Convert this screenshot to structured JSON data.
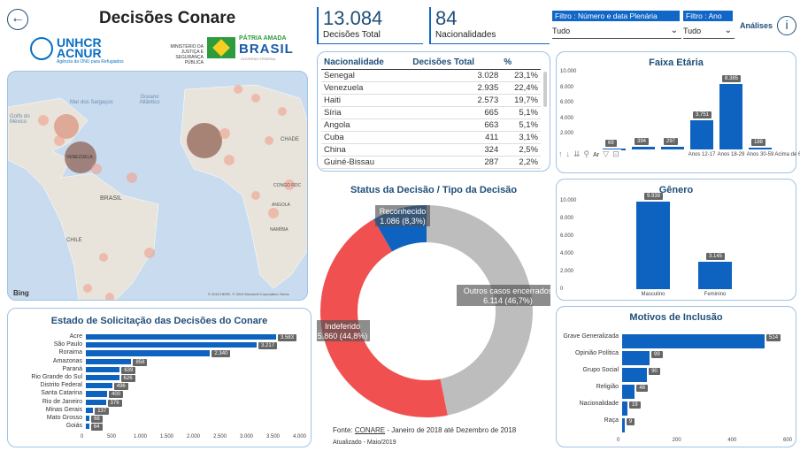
{
  "header": {
    "title": "Decisões Conare",
    "unhcr_line1": "UNHCR",
    "unhcr_line2": "ACNUR",
    "unhcr_sub": "Agência da ONU para Refugiados",
    "ministry": "MINISTÉRIO DA JUSTIÇA E SEGURANÇA PÚBLICA",
    "brasil_top": "PÁTRIA AMADA",
    "brasil_main": "BRASIL",
    "brasil_sub": "GOVERNO FEDERAL"
  },
  "kpis": {
    "decisoes_value": "13.084",
    "decisoes_label": "Decisões Total",
    "nac_value": "84",
    "nac_label": "Nacionalidades"
  },
  "filters": {
    "f1_label": "Filtro : Número e data Plenária",
    "f1_value": "Tudo",
    "f2_label": "Filtro : Ano",
    "f2_value": "Tudo",
    "analises": "Análises"
  },
  "map": {
    "ocean1": "Mar dos Sargaços",
    "ocean2": "Oceano Atlântico",
    "golfo": "Golfo do México",
    "brasil": "BRASIL",
    "chile": "CHILE",
    "venezuela": "VENEZUELA",
    "chade": "CHADE",
    "congo": "CONGO RDC",
    "namibia": "NAMÍBIA",
    "angola": "ANGOLA",
    "bing": "Bing",
    "copyright": "© 2019 HERE, © 2019 Microsoft Corporation Terms"
  },
  "table": {
    "headers": [
      "Nacionalidade",
      "Decisões Total",
      "%"
    ],
    "rows": [
      [
        "Senegal",
        "3.028",
        "23,1%"
      ],
      [
        "Venezuela",
        "2.935",
        "22,4%"
      ],
      [
        "Haiti",
        "2.573",
        "19,7%"
      ],
      [
        "Síria",
        "665",
        "5,1%"
      ],
      [
        "Angola",
        "663",
        "5,1%"
      ],
      [
        "Cuba",
        "411",
        "3,1%"
      ],
      [
        "China",
        "324",
        "2,5%"
      ],
      [
        "Guiné-Bissau",
        "287",
        "2,2%"
      ]
    ]
  },
  "chart_data": [
    {
      "type": "bar",
      "orientation": "horizontal",
      "title": "Estado de Solicitação das Decisões do Conare",
      "categories": [
        "Acre",
        "São Paulo",
        "Roraima",
        "Amazonas",
        "Paraná",
        "Rio Grande do Sul",
        "Distrito Federal",
        "Santa Catarina",
        "Rio de Janeiro",
        "Minas Gerais",
        "Mato Grosso",
        "Goiás"
      ],
      "values": [
        3583,
        3217,
        2340,
        858,
        639,
        626,
        496,
        400,
        376,
        137,
        68,
        64
      ],
      "value_labels": [
        "3.583",
        "3.217",
        "2.340",
        "858",
        "639",
        "626",
        "496",
        "400",
        "376",
        "137",
        "68",
        "64"
      ],
      "xlim": [
        0,
        4000
      ],
      "ticks": [
        "0",
        "500",
        "1.000",
        "1.500",
        "2.000",
        "2.500",
        "3.000",
        "3.500",
        "4.000"
      ]
    },
    {
      "type": "pie",
      "title": "Status da Decisão / Tipo da Decisão",
      "slices": [
        {
          "name": "Outros casos encerrados",
          "value": 6114,
          "label": "6.114 (46,7%)",
          "color": "#bdbdbd"
        },
        {
          "name": "Indeferido",
          "value": 5860,
          "label": "5.860 (44,8%)",
          "color": "#f05050"
        },
        {
          "name": "Reconhecido",
          "value": 1086,
          "label": "1.086 (8,3%)",
          "color": "#0f63c0"
        }
      ]
    },
    {
      "type": "bar",
      "title": "Faixa Etária",
      "categories": [
        "",
        "",
        "",
        "Anos 12-17",
        "Anos 18-29",
        "Anos 30-59",
        "Acima de 60"
      ],
      "values": [
        69,
        394,
        297,
        3751,
        8385,
        188
      ],
      "value_labels": [
        "69",
        "394",
        "297",
        "3.751",
        "8.385",
        "188"
      ],
      "ylim": [
        0,
        10000
      ],
      "ticks": [
        "10.000",
        "8.000",
        "6.000",
        "4.000",
        "2.000"
      ]
    },
    {
      "type": "bar",
      "title": "Gênero",
      "categories": [
        "Masculino",
        "Feminino"
      ],
      "values": [
        9939,
        3145
      ],
      "value_labels": [
        "9.939",
        "3.145"
      ],
      "ylim": [
        0,
        10000
      ],
      "ticks": [
        "10.000",
        "8.000",
        "6.000",
        "4.000",
        "2.000",
        "0"
      ]
    },
    {
      "type": "bar",
      "orientation": "horizontal",
      "title": "Motivos de Inclusão",
      "categories": [
        "Grave Generalizada",
        "Opinião Política",
        "Grupo Social",
        "Religião",
        "Nacionalidade",
        "Raça"
      ],
      "values": [
        514,
        99,
        90,
        46,
        19,
        9
      ],
      "value_labels": [
        "514",
        "99",
        "90",
        "46",
        "19",
        "9"
      ],
      "xlim": [
        0,
        600
      ],
      "ticks": [
        "0",
        "200",
        "400",
        "600"
      ]
    }
  ],
  "footer": {
    "fonte_prefix": "Fonte: ",
    "fonte_link": "CONARE",
    "fonte_rest": " - Janeiro de 2018 até Dezembro de 2018",
    "atualizado": "Atualizado - Maio/2019"
  },
  "faixa_truncated": "Ar"
}
